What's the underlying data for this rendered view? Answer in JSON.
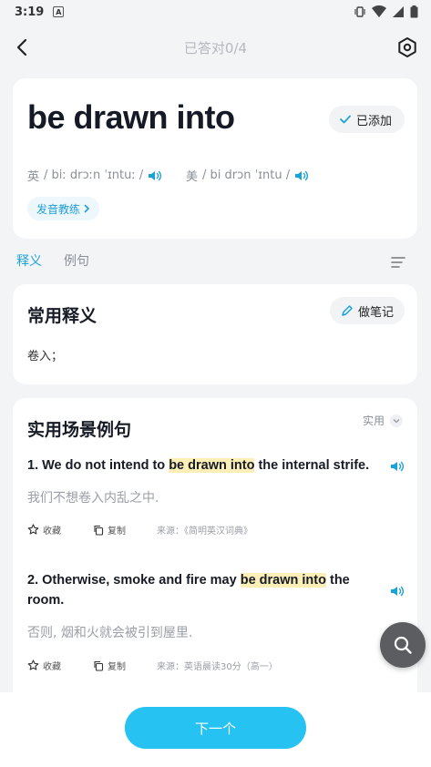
{
  "status_bar": {
    "time": "3:19",
    "notif_glyph": "A"
  },
  "nav": {
    "title": "已答对0/4"
  },
  "word_card": {
    "word": "be drawn into",
    "added_label": "已添加",
    "uk_label": "英",
    "uk_phonetic": "/ biː drɔːn ˈɪntuː /",
    "us_label": "美",
    "us_phonetic": "/ bi drɔn ˈɪntu /",
    "practice_label": "发音教练"
  },
  "tabs": [
    {
      "label": "释义",
      "active": true
    },
    {
      "label": "例句",
      "active": false
    }
  ],
  "definition": {
    "title": "常用释义",
    "note_label": "做笔记",
    "text": "卷入；"
  },
  "examples": {
    "title": "实用场景例句",
    "filter_label": "实用",
    "items": [
      {
        "pre": "1. We do not intend to ",
        "highlight": "be drawn into",
        "post": " the internal strife.",
        "translation": "我们不想卷入内乱之中.",
        "collect_label": "收藏",
        "copy_label": "复制",
        "source": "来源：《简明英汉词典》"
      },
      {
        "pre": "2. Otherwise, smoke and fire may ",
        "highlight": "be drawn into",
        "post": " the room.",
        "translation": "否则, 烟和火就会被引到屋里.",
        "collect_label": "收藏",
        "copy_label": "复制",
        "source": "来源：英语晨读30分（高一）"
      }
    ]
  },
  "next_button": {
    "label": "下一个"
  },
  "colors": {
    "accent": "#25c2f2",
    "link": "#1aa3d9",
    "highlight": "#fbefb7"
  }
}
